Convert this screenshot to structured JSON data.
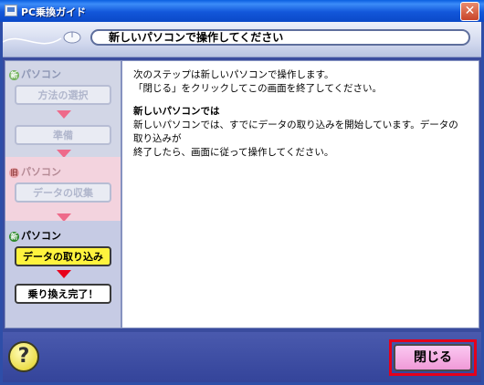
{
  "window": {
    "title": "PC乗換ガイド",
    "close_symbol": "✕"
  },
  "header": {
    "title": "新しいパソコンで操作してください"
  },
  "steps": {
    "old_section": {
      "badge": "新",
      "label": "パソコン"
    },
    "step1": "方法の選択",
    "step2": "準備",
    "old2_section": {
      "badge": "旧",
      "label": "パソコン"
    },
    "step3": "データの収集",
    "new_section": {
      "badge": "新",
      "label": "パソコン"
    },
    "step4": "データの取り込み",
    "step5": "乗り換え完了！"
  },
  "content": {
    "intro_line1": "次のステップは新しいパソコンで操作します。",
    "intro_line2": "「閉じる」をクリックしてこの画面を終了してください。",
    "subheading": "新しいパソコンでは",
    "body_line1": "新しいパソコンでは、すでにデータの取り込みを開始しています。データの取り込みが",
    "body_line2": "終了したら、画面に従って操作してください。"
  },
  "footer": {
    "help_symbol": "?",
    "close_label": "閉じる"
  },
  "colors": {
    "title_bar": "#1257DA",
    "client_frame": "#3A4C9E",
    "current_step": "#FFF33E",
    "close_button": "#F09AD8",
    "highlight_border": "#E4001B"
  }
}
